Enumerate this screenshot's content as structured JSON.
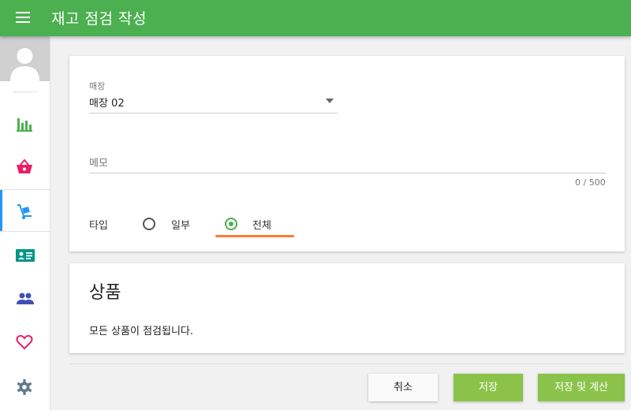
{
  "appbar": {
    "title": "재고 점검 작성"
  },
  "form": {
    "store_label": "매장",
    "store_value": "매장 02",
    "memo_placeholder": "메모",
    "memo_counter": "0 / 500",
    "type_label": "타입",
    "type_options": [
      {
        "label": "일부",
        "selected": false
      },
      {
        "label": "전체",
        "selected": true
      }
    ]
  },
  "products": {
    "title": "상품",
    "message": "모든 상품이 점검됩니다."
  },
  "actions": {
    "cancel": "취소",
    "save": "저장",
    "save_and_calc": "저장 및 계산"
  },
  "sidebar": {
    "items": [
      {
        "icon": "bar-chart-icon",
        "color": "#4caf50"
      },
      {
        "icon": "basket-icon",
        "color": "#e91e63"
      },
      {
        "icon": "hand-truck-icon",
        "color": "#2196f3",
        "active": true
      },
      {
        "icon": "id-card-icon",
        "color": "#009688"
      },
      {
        "icon": "people-icon",
        "color": "#3f51b5"
      },
      {
        "icon": "heart-icon",
        "color": "#e91e63"
      },
      {
        "icon": "gear-icon",
        "color": "#607d8b"
      }
    ]
  },
  "colors": {
    "primary": "#4caf50",
    "button": "#8bc34a",
    "focus": "#ff7a35"
  }
}
